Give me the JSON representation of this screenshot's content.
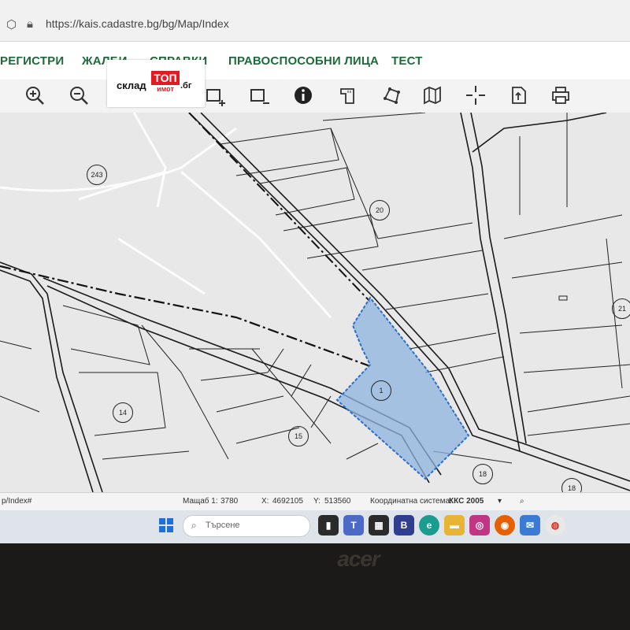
{
  "browser": {
    "url": "https://kais.cadastre.bg/bg/Map/Index"
  },
  "menu": {
    "items": [
      "РЕГИСТРИ",
      "ЖАЛБИ",
      "СПРАВКИ",
      "ПРАВОСПОСОБНИ ЛИЦА",
      "ТЕСТ"
    ]
  },
  "toolbar": {
    "tools": [
      "zoom-in-icon",
      "zoom-out-icon",
      "pan-icon",
      "add-rectangle-icon",
      "remove-rectangle-icon",
      "info-icon",
      "measure-icon",
      "polygon-icon",
      "map-icon",
      "crosshair-icon",
      "export-icon",
      "print-icon"
    ]
  },
  "logo": {
    "left": "склад",
    "box": "ТОП",
    "sub": "имот",
    "right": ".бг"
  },
  "map": {
    "parcels": [
      "243",
      "20",
      "21",
      "1",
      "14",
      "15",
      "18",
      "18"
    ],
    "highlight_color": "#8fb4e0"
  },
  "status": {
    "scale_label": "Мащаб 1:",
    "scale_value": "3780",
    "x_label": "X:",
    "x_value": "4692105",
    "y_label": "Y:",
    "y_value": "513560",
    "coord_label": "Координатна система:",
    "coord_value": "ККС 2005",
    "url_hint": "p/Index#"
  },
  "taskbar": {
    "search_placeholder": "Търсене"
  },
  "bezel": {
    "brand": "acer"
  }
}
